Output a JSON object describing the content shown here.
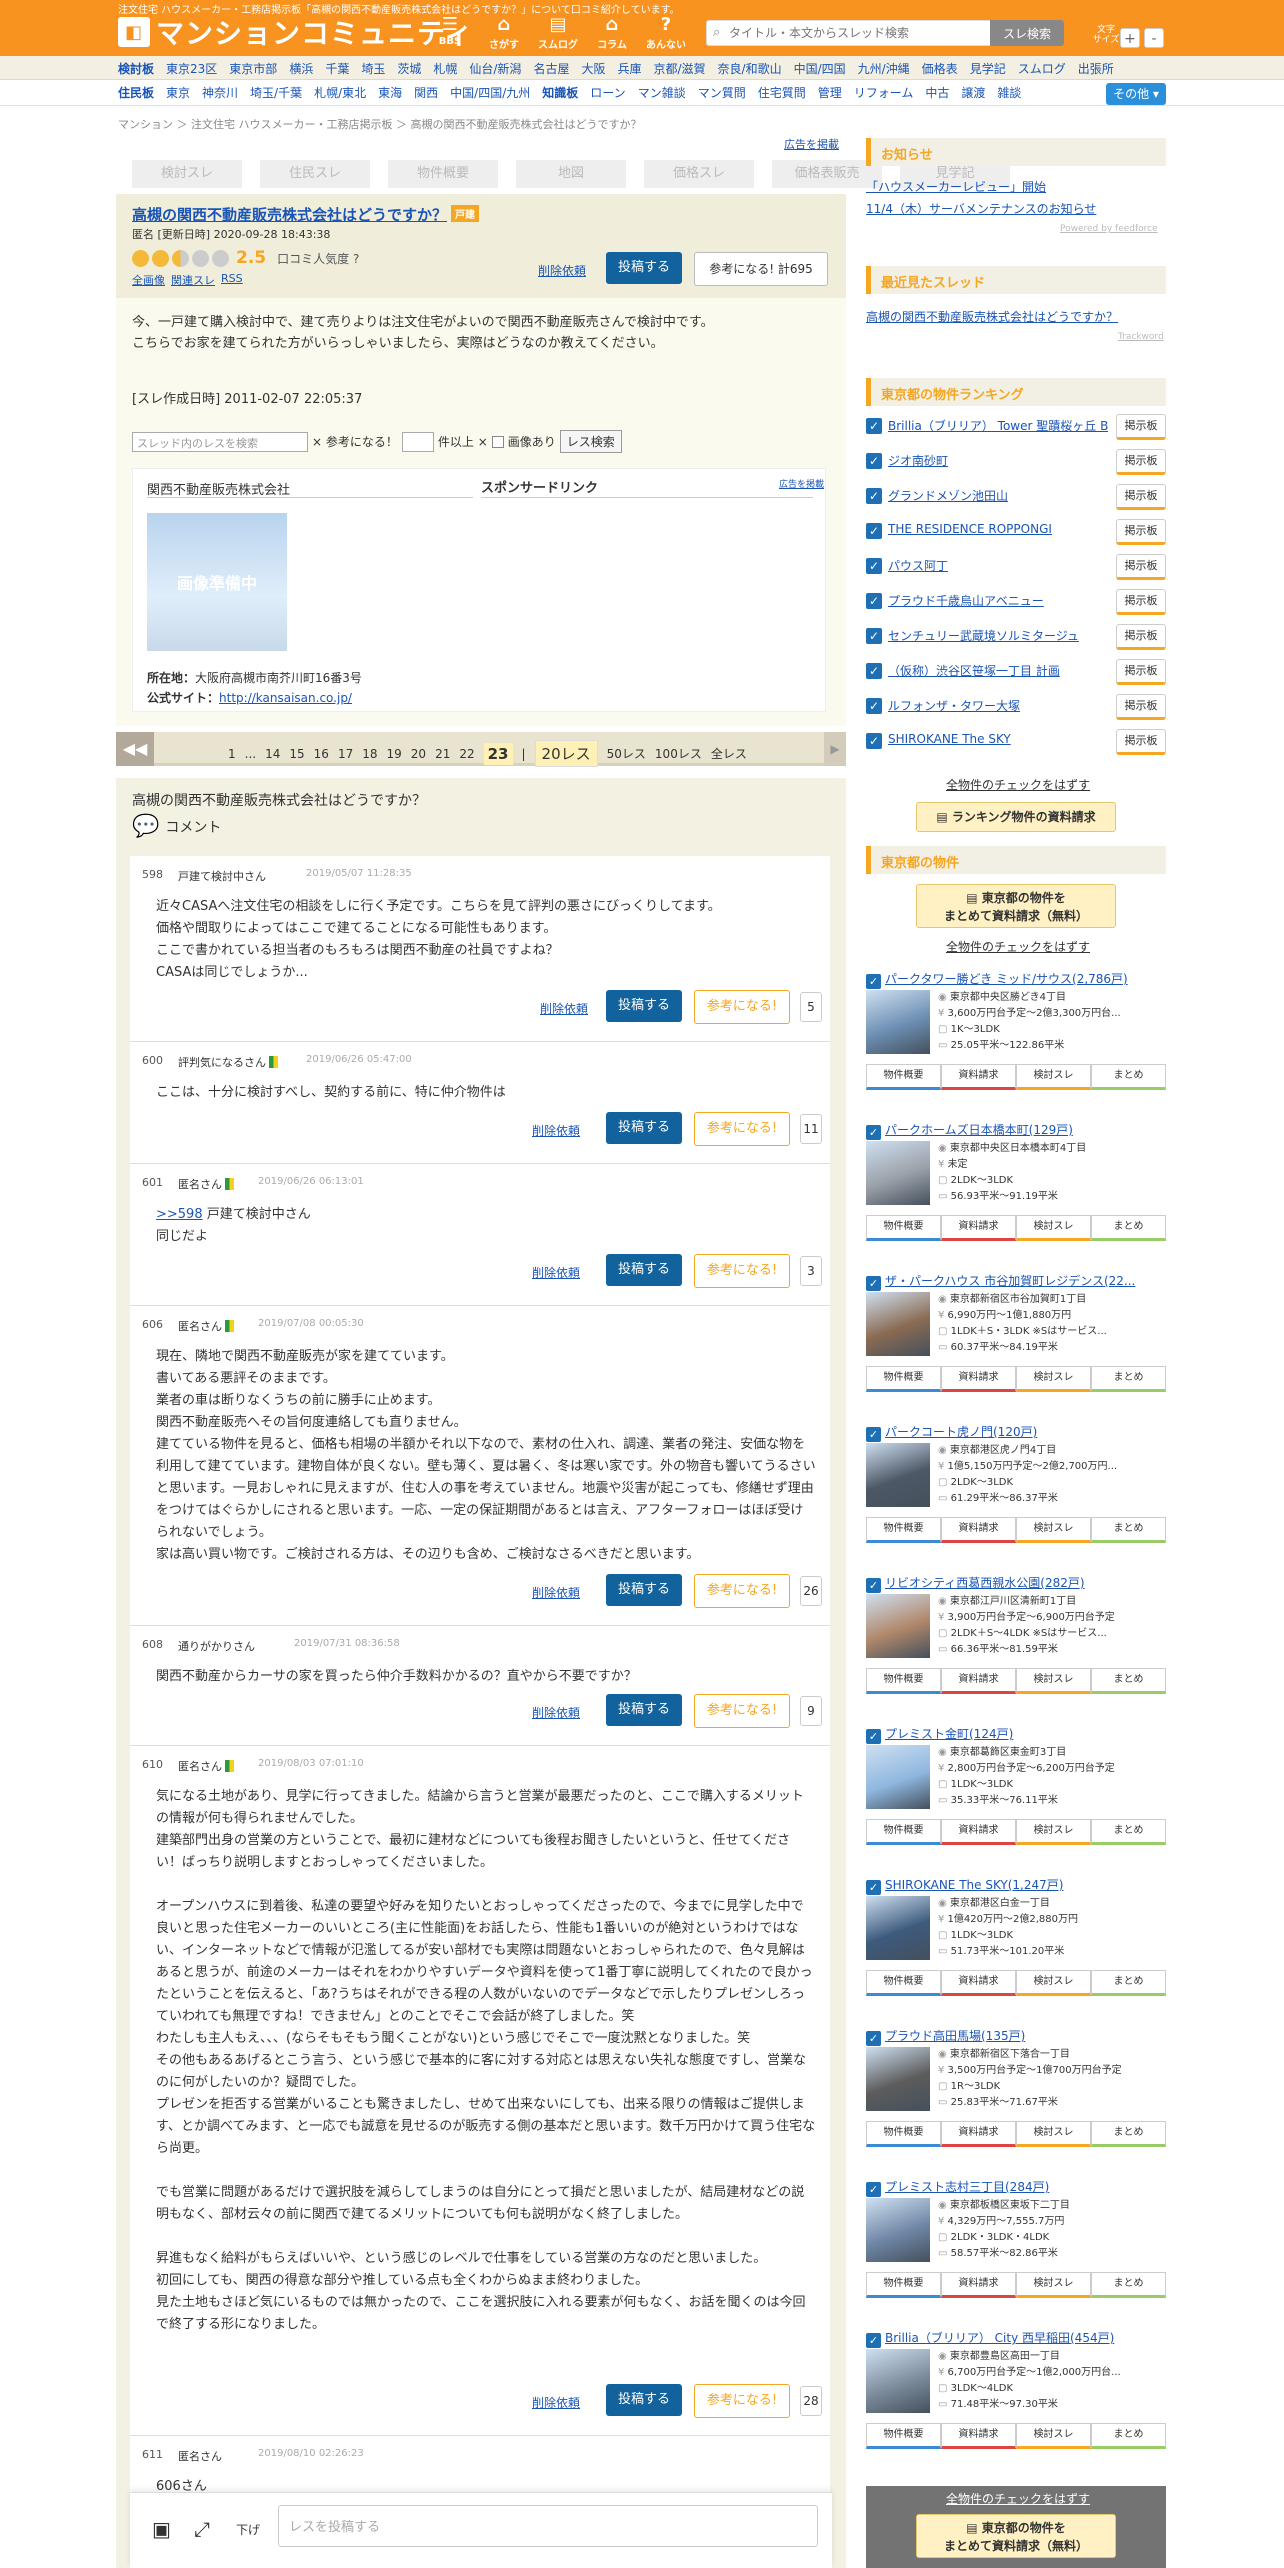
{
  "header": {
    "tagline": "注文住宅 ハウスメーカー・工務店掲示板「高槻の関西不動産販売株式会社はどうですか？」について口コミ紹介しています。",
    "logo_text": "マンションコミュニティ",
    "nav": [
      {
        "label": "BBS",
        "icon": "☰"
      },
      {
        "label": "さがす",
        "icon": "⌂"
      },
      {
        "label": "スムログ",
        "icon": "▤"
      },
      {
        "label": "コラム",
        "icon": "⌂"
      },
      {
        "label": "あんない",
        "icon": "?"
      }
    ],
    "search_placeholder": "タイトル・本文からスレッド検索",
    "search_button": "スレ検索",
    "font_size_label": "文字\nサイズ",
    "font_plus": "+",
    "font_minus": "-"
  },
  "nav1": {
    "label": "検討板",
    "items": [
      "東京23区",
      "東京市部",
      "横浜",
      "千葉",
      "埼玉",
      "茨城",
      "札幌",
      "仙台/新潟",
      "名古屋",
      "大阪",
      "兵庫",
      "京都/滋賀",
      "奈良/和歌山",
      "中国/四国",
      "九州/沖縄",
      "価格表",
      "見学記",
      "スムログ",
      "出張所"
    ]
  },
  "nav2": {
    "label": "住民板",
    "items": [
      "東京",
      "神奈川",
      "埼玉/千葉",
      "札幌/東北",
      "東海",
      "関西",
      "中国/四国/九州"
    ],
    "label2": "知識板",
    "items2": [
      "ローン",
      "マン雑談",
      "マン質問",
      "住宅質問",
      "管理",
      "リフォーム",
      "中古",
      "譲渡",
      "雑談"
    ],
    "other_button": "その他 ▾"
  },
  "breadcrumb": "マンション ＞ 注文住宅 ハウスメーカー・工務店掲示板 ＞ 高槻の関西不動産販売株式会社はどうですか？",
  "ad_link": "広告を掲載",
  "tabs": [
    "検討スレ",
    "住民スレ",
    "物件概要",
    "地図",
    "価格スレ",
    "価格表販売",
    "見学記"
  ],
  "thread": {
    "title": "高槻の関西不動産販売株式会社はどうですか？",
    "tag": "戸建",
    "meta": "匿名 [更新日時] 2020-09-28 18:43:38",
    "score": "2.5",
    "popularity_label": "口コミ人気度 ?",
    "links": [
      "全画像",
      "関連スレ",
      "RSS"
    ],
    "delete_link": "削除依頼",
    "post_button": "投稿する",
    "helpful_button": "参考になる! 計695",
    "body": [
      "今、一戸建て購入検討中で、建て売りよりは注文住宅がよいので関西不動産販売さんで検討中です。",
      "こちらでお家を建てられた方がいらっしゃいましたら、実際はどうなのか教えてください。"
    ],
    "created": "[スレ作成日時] 2011-02-07 22:05:37"
  },
  "filter": {
    "placeholder": "スレッド内のレスを検索",
    "sankou": "× 参考になる！",
    "ken": "件以上 ×",
    "image": "画像あり",
    "button": "レス検索"
  },
  "company": {
    "name": "関西不動産販売株式会社",
    "sponsor": "スポンサードリンク",
    "ad": "広告を掲載",
    "no_image": "画像準備中",
    "address_label": "所在地：",
    "address": "大阪府高槻市南芥川町16番3号",
    "site_label": "公式サイト：",
    "site": "http://kansaisan.co.jp/"
  },
  "pager": {
    "pages": [
      "1",
      "...",
      "14",
      "15",
      "16",
      "17",
      "18",
      "19",
      "20",
      "21",
      "22"
    ],
    "current": "23",
    "sep": "|",
    "selected": "20レス",
    "options": [
      "50レス",
      "100レス",
      "全レス"
    ]
  },
  "comments": {
    "title": "高槻の関西不動産販売株式会社はどうですか？",
    "sub": "コメント",
    "delete": "削除依頼",
    "post": "投稿する",
    "helpful": "参考になる!"
  },
  "posts": [
    {
      "num": "598",
      "name": "戸建て検討中さん",
      "beginner": false,
      "date": "2019/05/07 11:28:35",
      "ref": "",
      "body": "近々CASAへ注文住宅の相談をしに行く予定です。こちらを見て評判の悪さにびっくりしてます。\n価格や間取りによってはここで建てることになる可能性もあります。\nここで書かれている担当者のもろもろは関西不動産の社員ですよね？\nCASAは同じでしょうか...",
      "count": "5"
    },
    {
      "num": "600",
      "name": "評判気になるさん",
      "beginner": true,
      "date": "2019/06/26 05:47:00",
      "ref": "",
      "body": "ここは、十分に検討すべし、契約する前に、特に仲介物件は",
      "count": "11"
    },
    {
      "num": "601",
      "name": "匿名さん",
      "beginner": true,
      "date": "2019/06/26 06:13:01",
      "ref": ">>598",
      "ref_suffix": " 戸建て検討中さん",
      "body": "同じだよ",
      "count": "3"
    },
    {
      "num": "606",
      "name": "匿名さん",
      "beginner": true,
      "date": "2019/07/08 00:05:30",
      "ref": "",
      "body": "現在、隣地で関西不動産販売が家を建てています。\n書いてある悪評そのままです。\n業者の車は断りなくうちの前に勝手に止めます。\n関西不動産販売へその旨何度連絡しても直りません。\n建てている物件を見ると、価格も相場の半額かそれ以下なので、素材の仕入れ、調達、業者の発注、安価な物を利用して建てています。建物自体が良くない。壁も薄く、夏は暑く、冬は寒い家です。外の物音も響いてうるさいと思います。一見おしゃれに見えますが、住む人の事を考えていません。地震や災害が起こっても、修繕せず理由をつけてはぐらかしにされると思います。一応、一定の保証期間があるとは言え、アフターフォローはほぼ受けられないでしょう。\n家は高い買い物です。ご検討される方は、その辺りも含め、ご検討なさるべきだと思います。",
      "count": "26"
    },
    {
      "num": "608",
      "name": "通りがかりさん",
      "beginner": false,
      "date": "2019/07/31 08:36:58",
      "ref": "",
      "body": "関西不動産からカーサの家を買ったら仲介手数料かかるの？直やから不要ですか？",
      "count": "9"
    },
    {
      "num": "610",
      "name": "匿名さん",
      "beginner": true,
      "date": "2019/08/03 07:01:10",
      "ref": "",
      "body": "気になる土地があり、見学に行ってきました。結論から言うと営業が最悪だったのと、ここで購入するメリットの情報が何も得られませんでした。\n建築部門出身の営業の方ということで、最初に建材などについても後程お聞きしたいというと、任せてください！ばっちり説明しますとおっしゃってくださいました。\n\nオープンハウスに到着後、私達の要望や好みを知りたいとおっしゃってくださったので、今までに見学した中で良いと思った住宅メーカーのいいところ(主に性能面)をお話したら、性能も1番いいのが絶対というわけではない、インターネットなどで情報が氾濫してるが安い部材でも実際は問題ないとおっしゃられたので、色々見解はあると思うが、前途のメーカーはそれをわかりやすいデータや資料を使って1番丁寧に説明してくれたので良かったということを伝えると、「あ?うちはそれができる程の人数がいないのでデータなどで示したりプレゼンしろっていわれても無理ですね！できません」とのことでそこで会話が終了しました。笑\nわたしも主人もえ、、、(ならそもそもう聞くことがない)という感じでそこで一度沈黙となりました。笑\nその他もあるあげるとこう言う、という感じで基本的に客に対する対応とは思えない失礼な態度ですし、営業なのに何がしたいのか？疑問でした。\nプレゼンを拒否する営業がいることも驚きましたし、せめて出来ないにしても、出来る限りの情報はご提供します、とか調べてみます、と一応でも誠意を見せるのが販売する側の基本だと思います。数千万円かけて買う住宅なら尚更。\n\nでも営業に問題があるだけで選択肢を減らしてしまうのは自分にとって損だと思いましたが、結局建材などの説明もなく、部材云々の前に関西で建てるメリットについても何も説明がなく終了しました。\n\n昇進もなく給料がもらえばいいや、という感じのレベルで仕事をしている営業の方なのだと思いました。\n初回にしても、関西の得意な部分や推している点も全くわからぬまま終わりました。\n見た土地もさほど気にいるものでは無かったので、ここを選択肢に入れる要素が何もなく、お話を聞くのは今回で終了する形になりました。",
      "count": "28"
    },
    {
      "num": "611",
      "name": "匿名さん",
      "beginner": false,
      "date": "2019/08/10 02:26:23",
      "ref": "",
      "body": "606さん",
      "count": ""
    }
  ],
  "bottom_bar": {
    "sage": "下げ",
    "placeholder": "レスを投稿する"
  },
  "sidebar": {
    "notice_head": "お知らせ",
    "notices": [
      "「ハウスメーカーレビュー」開始",
      "11/4（木）サーバメンテナンスのお知らせ"
    ],
    "powered": "Powered by feedforce",
    "recent_head": "最近見たスレッド",
    "recent": [
      "高槻の関西不動産販売株式会社はどうですか？"
    ],
    "trackword": "Trackword",
    "ranking_head": "東京都の物件ランキング",
    "ranking": [
      "Brillia（ブリリア） Tower 聖蹟桜ヶ丘 BLOOMING RESIDENCE",
      "ジオ南砂町",
      "グランドメゾン池田山",
      "THE RESIDENCE ROPPONGI",
      "パウス阿丁",
      "プラウド千歳烏山アベニュー",
      "センチュリー武蔵境ソルミタージュ",
      "（仮称）渋谷区笹塚一丁目 計画",
      "ルフォンザ・タワー大塚",
      "SHIROKANE The SKY"
    ],
    "keijiban": "掲示板",
    "uncheck": "全物件のチェックをはずす",
    "ranking_request": "ランキング物件の資料請求",
    "tokyo_head": "東京都の物件",
    "tokyo_request": [
      "東京都の物件を",
      "まとめて資料請求（無料）"
    ],
    "btns": [
      "物件概要",
      "資料請求",
      "検討スレ",
      "まとめ"
    ],
    "properties": [
      {
        "title": "パークタワー勝どき ミッド/サウス(2,786戸)",
        "info": [
          "東京都中央区勝どき4丁目",
          "3,600万円台予定～2億3,300万円台...",
          "1K～3LDK",
          "25.05平米～122.86平米"
        ],
        "color": "#6d8fb3"
      },
      {
        "title": "パークホームズ日本橋本町(129戸)",
        "info": [
          "東京都中央区日本橋本町4丁目",
          "未定",
          "2LDK～3LDK",
          "56.93平米～91.19平米"
        ],
        "color": "#9aa0a8"
      },
      {
        "title": "ザ・パークハウス 市谷加賀町レジデンス(22...",
        "info": [
          "東京都新宿区市谷加賀町1丁目",
          "6,990万円～1億1,880万円",
          "1LDK＋S・3LDK ※Sはサービス...",
          "60.37平米～84.19平米"
        ],
        "color": "#8a6b52"
      },
      {
        "title": "パークコート虎ノ門(120戸)",
        "info": [
          "東京都港区虎ノ門4丁目",
          "1億5,150万円予定～2億2,700万円...",
          "2LDK～3LDK",
          "61.29平米～86.37平米"
        ],
        "color": "#4d5866"
      },
      {
        "title": "リビオシティ西葛西親水公園(282戸)",
        "info": [
          "東京都江戸川区清新町1丁目",
          "3,900万円台予定～6,900万円台予定",
          "2LDK＋S～4LDK ※Sはサービス...",
          "66.36平米～81.59平米"
        ],
        "color": "#b0876a"
      },
      {
        "title": "プレミスト金町(124戸)",
        "info": [
          "東京都葛飾区東金町3丁目",
          "2,800万円台予定～6,200万円台予定",
          "1LDK～3LDK",
          "35.33平米～76.11平米"
        ],
        "color": "#8fb7df"
      },
      {
        "title": "SHIROKANE The SKY(1,247戸)",
        "info": [
          "東京都港区白金一丁目",
          "1億420万円～2億2,880万円",
          "1LDK～3LDK",
          "51.73平米～101.20平米"
        ],
        "color": "#3d5a7d"
      },
      {
        "title": "プラウド高田馬場(135戸)",
        "info": [
          "東京都新宿区下落合一丁目",
          "3,500万円台予定～1億700万円台予定",
          "1R～3LDK",
          "25.83平米～71.67平米"
        ],
        "color": "#5c5c5c"
      },
      {
        "title": "プレミスト志村三丁目(284戸)",
        "info": [
          "東京都板橋区東坂下二丁目",
          "4,329万円～7,555.7万円",
          "2LDK・3LDK・4LDK",
          "58.57平米～82.86平米"
        ],
        "color": "#6f87a6"
      },
      {
        "title": "Brillia（ブリリア） City 西早稲田(454戸)",
        "info": [
          "東京都豊島区高田一丁目",
          "6,700万円台予定～1億2,000万円台...",
          "3LDK～4LDK",
          "71.48平米～97.30平米"
        ],
        "color": "#7c8c9c"
      }
    ],
    "float_caption": "全物件のチェックをはずす",
    "float_request": [
      "東京都の物件を",
      "まとめて資料請求（無料）"
    ]
  }
}
